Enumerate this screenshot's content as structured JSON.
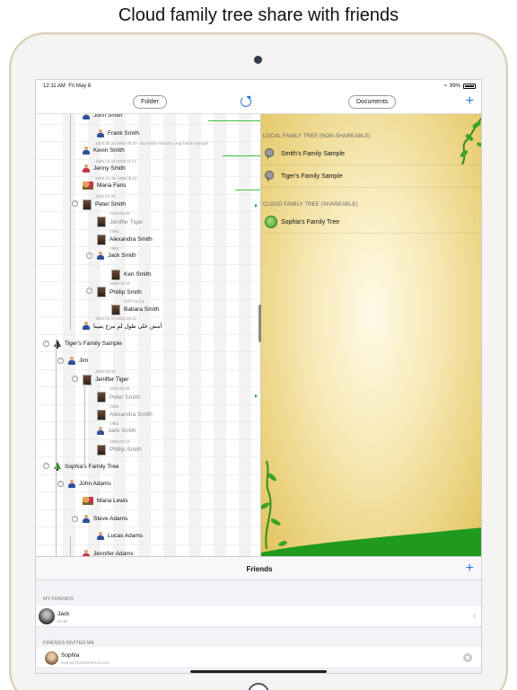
{
  "headline": "Cloud family tree share with friends",
  "status": {
    "time": "12:11 AM",
    "date": "Fri May 8",
    "battery": "99%"
  },
  "toolbar": {
    "folder_label": "Folder",
    "documents_label": "Documents",
    "add_label": "+"
  },
  "tree_rows": [
    {
      "name": "John Smith",
      "sub": "",
      "icon": "person",
      "indent": 3,
      "toggle": false,
      "muted": false
    },
    {
      "name": "Frank Smith",
      "sub": "",
      "icon": "person",
      "indent": 4,
      "toggle": false,
      "muted": false
    },
    {
      "name": "Kevin Smith",
      "sub": "1823.05.22-2002.05.23 · By Sophy Woods Long Name Sample",
      "icon": "person",
      "indent": 3,
      "toggle": false,
      "muted": false
    },
    {
      "name": "Jenny Smith",
      "sub": "1925.10.03-2000.11.17",
      "icon": "person-female",
      "indent": 3,
      "toggle": false,
      "muted": false
    },
    {
      "name": "Maria Fans",
      "sub": "1928.12.09-1988.09.12",
      "icon": "family",
      "indent": 3,
      "toggle": false,
      "muted": false
    },
    {
      "name": "Peter Smith",
      "sub": "1933.04.05",
      "icon": "photo",
      "indent": 3,
      "toggle": true,
      "muted": false
    },
    {
      "name": "Jeniffer Tiger",
      "sub": "1939.05.08",
      "icon": "photo",
      "indent": 4,
      "toggle": false,
      "muted": true
    },
    {
      "name": "Alexandra Smith",
      "sub": "1965",
      "icon": "photo",
      "indent": 4,
      "toggle": false,
      "muted": false
    },
    {
      "name": "Jack Smith",
      "sub": "1963",
      "icon": "person",
      "indent": 4,
      "toggle": true,
      "muted": false
    },
    {
      "name": "Ken Smith",
      "sub": "",
      "icon": "photo",
      "indent": 5,
      "toggle": false,
      "muted": false
    },
    {
      "name": "Phillip Smith",
      "sub": "1969.03.16",
      "icon": "photo",
      "indent": 4,
      "toggle": true,
      "muted": false
    },
    {
      "name": "Babara Smith",
      "sub": "2007.02.14",
      "icon": "photo",
      "indent": 5,
      "toggle": false,
      "muted": false
    },
    {
      "name": "آمش على طول لم مزج يمينا",
      "sub": "1934.02.07-2011.09.12",
      "icon": "person",
      "indent": 3,
      "toggle": false,
      "muted": false
    },
    {
      "name": "Tiger's Family Sample",
      "sub": "",
      "icon": "tree",
      "indent": 1,
      "toggle": true,
      "muted": false
    },
    {
      "name": "Jim",
      "sub": "",
      "icon": "person",
      "indent": 2,
      "toggle": true,
      "muted": false
    },
    {
      "name": "Jeniffer Tiger",
      "sub": "1939.05.08",
      "icon": "photo",
      "indent": 3,
      "toggle": true,
      "muted": false
    },
    {
      "name": "Peter Smith",
      "sub": "1933.04.05",
      "icon": "photo",
      "indent": 4,
      "toggle": false,
      "muted": true
    },
    {
      "name": "Alexandra Smith",
      "sub": "1965",
      "icon": "photo",
      "indent": 4,
      "toggle": false,
      "muted": true
    },
    {
      "name": "Jack Smith",
      "sub": "1963",
      "icon": "person",
      "indent": 4,
      "toggle": false,
      "muted": true
    },
    {
      "name": "Phillip Smith",
      "sub": "1969.03.16",
      "icon": "photo",
      "indent": 4,
      "toggle": false,
      "muted": true
    },
    {
      "name": "Sophia's Family Tree",
      "sub": "",
      "icon": "tree-green",
      "indent": 1,
      "toggle": true,
      "muted": false
    },
    {
      "name": "John Adams",
      "sub": "",
      "icon": "person",
      "indent": 2,
      "toggle": true,
      "muted": false
    },
    {
      "name": "Maria Lewis",
      "sub": "",
      "icon": "family",
      "indent": 3,
      "toggle": false,
      "muted": false
    },
    {
      "name": "Steve Adams",
      "sub": "",
      "icon": "person",
      "indent": 3,
      "toggle": true,
      "muted": false
    },
    {
      "name": "Lucas Adams",
      "sub": "",
      "icon": "person",
      "indent": 4,
      "toggle": false,
      "muted": false
    },
    {
      "name": "Jennifer Adams",
      "sub": "",
      "icon": "person-female",
      "indent": 3,
      "toggle": false,
      "muted": false
    }
  ],
  "documents": {
    "local_header": "LOCAL FAMILY TREE (NON-SHAREABLE)",
    "local_items": [
      "Smith's Family Sample",
      "Tiger's Family Sample"
    ],
    "cloud_header": "CLOUD FAMILY TREE (SHAREABLE)",
    "cloud_items": [
      "Sophia's Family Tree"
    ]
  },
  "friends": {
    "title": "Friends",
    "add_label": "+",
    "my_friends_header": "MY FRIENDS",
    "my_friends": [
      {
        "name": "Jack",
        "sub": "Email"
      }
    ],
    "invited_header": "FRIENDS INVITED ME",
    "invited": [
      {
        "name": "Sophia",
        "sub": "sophia@heavenbrook.com"
      }
    ]
  },
  "colors": {
    "accent": "#2a7be0",
    "green": "#3ec13e",
    "parchment": "#e2c35b"
  }
}
